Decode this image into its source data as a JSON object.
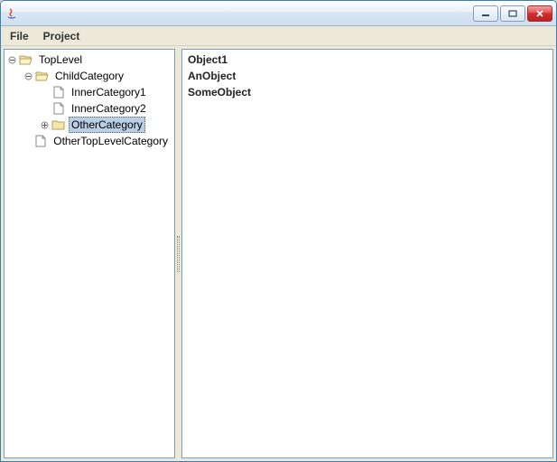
{
  "window": {
    "title": ""
  },
  "menubar": {
    "items": [
      "File",
      "Project"
    ]
  },
  "tree": {
    "nodes": [
      {
        "label": "TopLevel",
        "depth": 0,
        "icon": "folder-open",
        "toggle": "expanded",
        "selected": false
      },
      {
        "label": "ChildCategory",
        "depth": 1,
        "icon": "folder-open",
        "toggle": "expanded",
        "selected": false
      },
      {
        "label": "InnerCategory1",
        "depth": 2,
        "icon": "file",
        "toggle": "none",
        "selected": false
      },
      {
        "label": "InnerCategory2",
        "depth": 2,
        "icon": "file",
        "toggle": "none",
        "selected": false
      },
      {
        "label": "OtherCategory",
        "depth": 2,
        "icon": "folder",
        "toggle": "collapsed",
        "selected": true
      },
      {
        "label": "OtherTopLevelCategory",
        "depth": 1,
        "icon": "file",
        "toggle": "none",
        "selected": false
      }
    ]
  },
  "list": {
    "items": [
      "Object1",
      "AnObject",
      "SomeObject"
    ]
  }
}
